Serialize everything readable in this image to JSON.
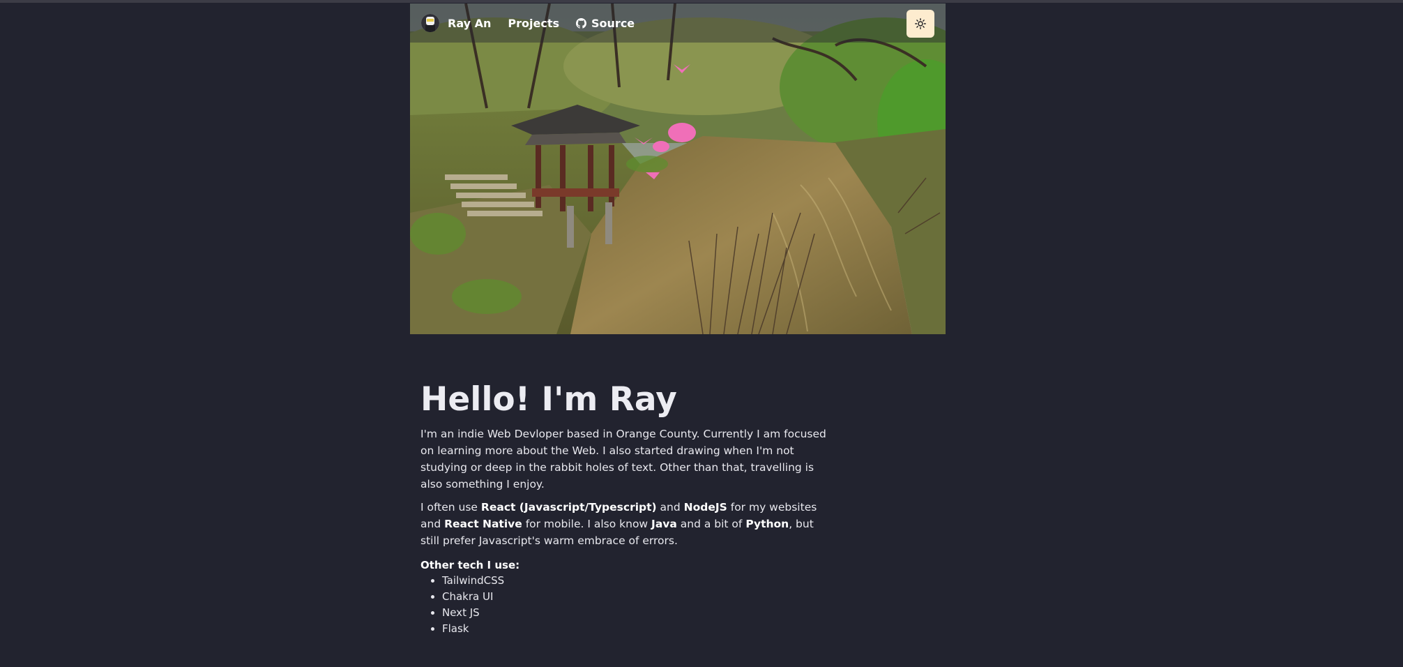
{
  "nav": {
    "brand": "Ray An",
    "projects": "Projects",
    "source": "Source"
  },
  "intro": {
    "heading": "Hello! I'm Ray",
    "paragraph1": "I'm an indie Web Devloper based in Orange County. Currently I am focused on learning more about the Web. I also started drawing when I'm not studying or deep in the rabbit holes of text. Other than that, travelling is also something I enjoy.",
    "p2": {
      "t1": "I often use ",
      "b1": "React (Javascript/Typescript)",
      "t2": " and ",
      "b2": "NodeJS",
      "t3": " for my websites and ",
      "b3": "React Native",
      "t4": " for mobile. I also know ",
      "b4": "Java",
      "t5": " and a bit of ",
      "b5": "Python",
      "t6": ", but still prefer Javascript's warm embrace of errors."
    }
  },
  "tech": {
    "heading": "Other tech I use:",
    "items": [
      "TailwindCSS",
      "Chakra UI",
      "Next JS",
      "Flask"
    ]
  },
  "icons": {
    "theme_toggle": "sun-icon",
    "source": "github-icon"
  },
  "colors": {
    "background": "#22232f",
    "theme_button": "#fdeccf"
  }
}
